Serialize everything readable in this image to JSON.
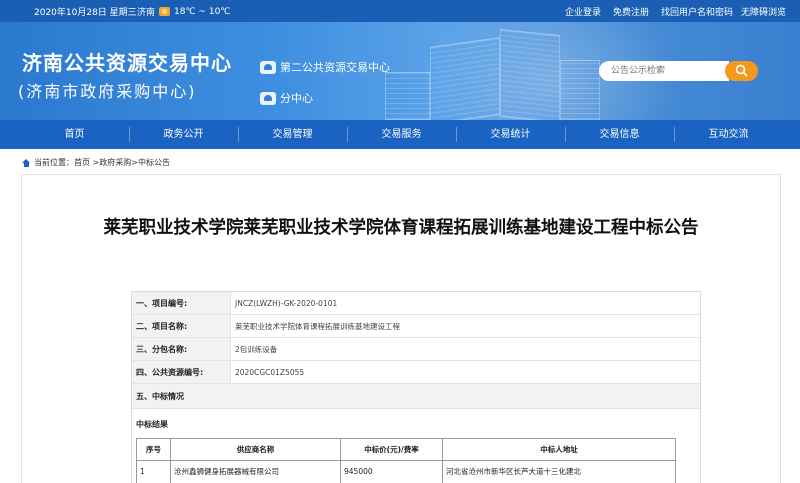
{
  "topbar": {
    "date": "2020年10月28日 星期三",
    "city": "济南",
    "temp": "18℃ ~ 10℃",
    "links": [
      "企业登录",
      "免费注册",
      "找回用户名和密码"
    ],
    "accessibility": "无障碍浏览"
  },
  "header": {
    "title": "济南公共资源交易中心",
    "subtitle": "(济南市政府采购中心)",
    "second_center": "第二公共资源交易中心",
    "branch": "分中心",
    "search_placeholder": "公告公示检索"
  },
  "nav": [
    "首页",
    "政务公开",
    "交易管理",
    "交易服务",
    "交易统计",
    "交易信息",
    "互动交流"
  ],
  "breadcrumb": "当前位置：首页 >政府采购>中标公告",
  "notice": {
    "title": "莱芜职业技术学院莱芜职业技术学院体育课程拓展训练基地建设工程中标公告",
    "fields": [
      {
        "label": "一、项目编号:",
        "value": "JNCZ(LWZH)-GK-2020-0101"
      },
      {
        "label": "二、项目名称:",
        "value": "莱芜职业技术学院体育课程拓展训练基地建设工程"
      },
      {
        "label": "三、分包名称:",
        "value": "2包训练设备"
      },
      {
        "label": "四、公共资源编号:",
        "value": "2020CGC01Z5055"
      }
    ],
    "section5": "五、中标情况",
    "result_label": "中标结果",
    "table": {
      "headers": [
        "序号",
        "供应商名称",
        "中标价(元)/费率",
        "中标人地址"
      ],
      "rows": [
        [
          "1",
          "沧州鑫狮健身拓展器械有限公司",
          "945000",
          "河北省沧州市新华区长芦大道十三化建北"
        ]
      ]
    }
  }
}
